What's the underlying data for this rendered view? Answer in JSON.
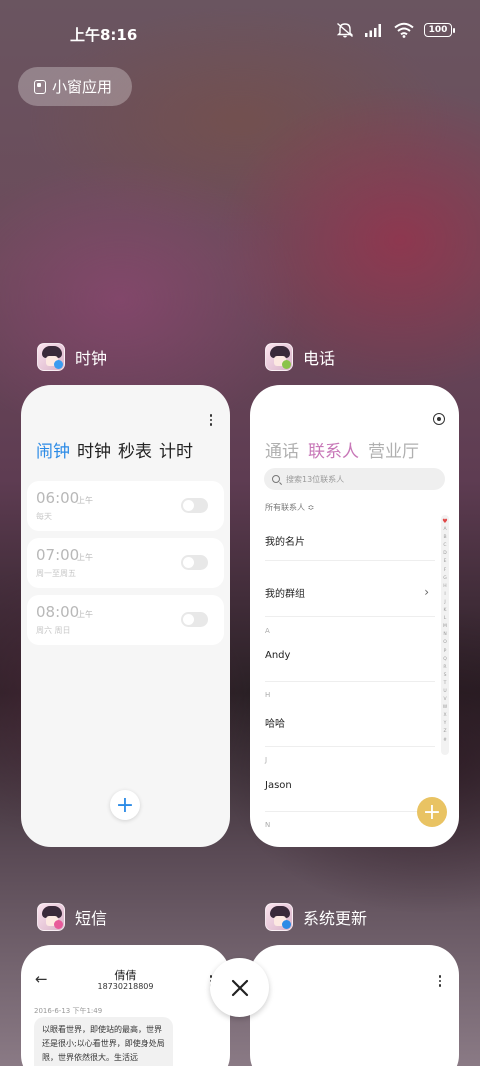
{
  "status_bar": {
    "time": "上午8:16",
    "battery": "100"
  },
  "small_window_button": {
    "label": "小窗应用"
  },
  "apps": {
    "clock": {
      "title": "时钟",
      "tabs": [
        "闹钟",
        "时钟",
        "秒表",
        "计时"
      ],
      "active_tab": "闹钟",
      "alarms": [
        {
          "time": "06:00",
          "ampm": "上午",
          "repeat": "每天",
          "enabled": false
        },
        {
          "time": "07:00",
          "ampm": "上午",
          "repeat": "周一至周五",
          "enabled": false
        },
        {
          "time": "08:00",
          "ampm": "上午",
          "repeat": "周六 周日",
          "enabled": false
        }
      ],
      "add_button": "+"
    },
    "phone": {
      "title": "电话",
      "tabs": [
        "通话",
        "联系人",
        "营业厅"
      ],
      "active_tab": "联系人",
      "search_placeholder": "搜索13位联系人",
      "filter": "所有联系人 ≎",
      "my_card": "我的名片",
      "my_groups": "我的群组",
      "sections": [
        {
          "letter": "A",
          "contact": "Andy"
        },
        {
          "letter": "H",
          "contact": "哈哈"
        },
        {
          "letter": "J",
          "contact": "Jason"
        },
        {
          "letter": "N",
          "contact": ""
        }
      ],
      "index_letters": [
        "A",
        "B",
        "C",
        "D",
        "E",
        "F",
        "G",
        "H",
        "I",
        "J",
        "K",
        "L",
        "M",
        "N",
        "O",
        "P",
        "Q",
        "R",
        "S",
        "T",
        "U",
        "V",
        "W",
        "X",
        "Y",
        "Z",
        "#"
      ],
      "add_button": "+"
    },
    "sms": {
      "title": "短信",
      "contact_name": "倩倩",
      "contact_number": "18730218809",
      "date": "2016-6-13 下午1:49",
      "message": "以眼看世界，即使站的最高，世界还是很小;以心看世界，即使身处局限，世界依然很大。生活远"
    },
    "update": {
      "title": "系统更新"
    }
  },
  "colors": {
    "clock_accent": "#2c8be6",
    "phone_accent": "#c878b8",
    "phone_fab": "#e9c363"
  }
}
